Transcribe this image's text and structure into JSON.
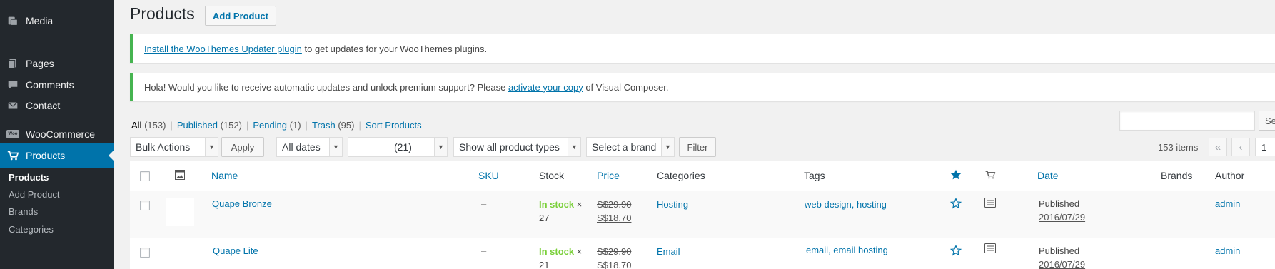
{
  "sidebar": {
    "media": "Media",
    "pages": "Pages",
    "comments": "Comments",
    "contact": "Contact",
    "woo_badge": "Woo",
    "woocommerce": "WooCommerce",
    "products": "Products",
    "sub": [
      "Products",
      "Add Product",
      "Brands",
      "Categories"
    ]
  },
  "header": {
    "title": "Products",
    "add_button": "Add Product"
  },
  "notices": {
    "n1_link": "Install the WooThemes Updater plugin",
    "n1_text": " to get updates for your WooThemes plugins.",
    "n2_text_a": "Hola! Would you like to receive automatic updates and unlock premium support? Please ",
    "n2_link": "activate your copy",
    "n2_text_b": " of Visual Composer."
  },
  "views": [
    {
      "label": "All",
      "count": "(153)"
    },
    {
      "label": "Published",
      "count": "(152)"
    },
    {
      "label": "Pending",
      "count": "(1)"
    },
    {
      "label": "Trash",
      "count": "(95)"
    },
    {
      "label": "Sort Products",
      "count": ""
    }
  ],
  "search": {
    "button": "Se"
  },
  "filters": {
    "bulk": "Bulk Actions",
    "apply": "Apply",
    "dates": "All dates",
    "cat": "(21)",
    "types": "Show all product types",
    "brand": "Select a brand",
    "filter": "Filter"
  },
  "pagination": {
    "items": "153 items",
    "first": "«",
    "prev": "‹",
    "page": "1"
  },
  "columns": {
    "name": "Name",
    "sku": "SKU",
    "stock": "Stock",
    "price": "Price",
    "categories": "Categories",
    "tags": "Tags",
    "date": "Date",
    "brands": "Brands",
    "author": "Author"
  },
  "rows": [
    {
      "name": "Quape Bronze",
      "sku": "–",
      "stock": "In stock",
      "stock_qty_a": " ×",
      "stock_qty_b": "27",
      "price_old": "S$29.90",
      "price_new": "S$18.70",
      "categories": "Hosting",
      "tags": "web design, hosting",
      "status": "Published",
      "date": "2016/07/29",
      "author": "admin"
    },
    {
      "name": "Quape Lite",
      "sku": "–",
      "stock": "In stock",
      "stock_qty_a": " ×",
      "stock_qty_b": "21",
      "price_old": "S$29.90",
      "price_new": "S$18.70",
      "categories": "Email",
      "tags": "email, email hosting",
      "status": "Published",
      "date": "2016/07/29",
      "author": "admin"
    }
  ],
  "colors": {
    "sidebar": "#23282d",
    "accent": "#0073aa",
    "instock": "#7ad03a",
    "notice_border": "#46b450"
  }
}
